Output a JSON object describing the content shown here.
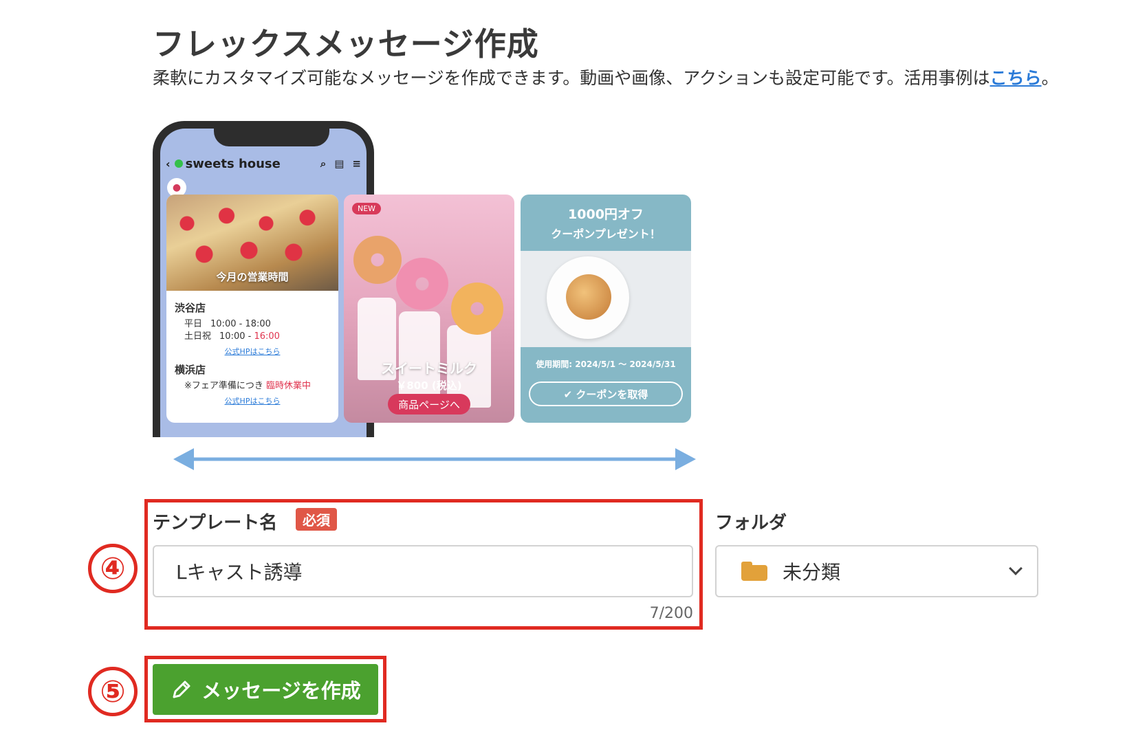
{
  "page": {
    "title": "フレックスメッセージ作成",
    "description": "柔軟にカスタマイズ可能なメッセージを作成できます。動画や画像、アクションも設定可能です。活用事例は",
    "description_link": "こちら",
    "description_end": "。"
  },
  "preview": {
    "chat_name": "sweets house",
    "card1": {
      "caption": "今月の営業時間",
      "store1": "渋谷店",
      "weekday_label": "平日",
      "weekday_hours": "10:00 - 18:00",
      "holiday_label": "土日祝",
      "holiday_hours_start": "10:00 - ",
      "holiday_hours_end": "16:00",
      "link1": "公式HPはこちら",
      "store2": "横浜店",
      "notice_prefix": "※フェア準備につき ",
      "notice_red": "臨時休業中",
      "link2": "公式HPはこちら"
    },
    "card2": {
      "badge": "NEW",
      "title": "スイートミルク",
      "price": "￥800 (税込)",
      "button": "商品ページへ"
    },
    "card3": {
      "title": "1000円オフ",
      "subtitle": "クーポンプレゼント！",
      "period": "使用期間: 2024/5/1 〜 2024/5/31",
      "button": "✔ クーポンを取得"
    }
  },
  "form": {
    "template_name_label": "テンプレート名",
    "required_badge": "必須",
    "template_name_value": "Lキャスト誘導",
    "counter": "7/200",
    "folder_label": "フォルダ",
    "folder_value": "未分類",
    "create_button": "メッセージを作成"
  },
  "annotations": {
    "step4": "④",
    "step5": "⑤"
  },
  "colors": {
    "highlight": "#e02a21",
    "button_green": "#4ba12f",
    "link_blue": "#2b7bd8",
    "required_red": "#e05747"
  }
}
